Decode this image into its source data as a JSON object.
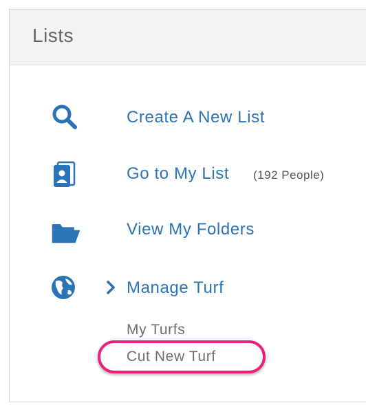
{
  "panel": {
    "title": "Lists"
  },
  "items": [
    {
      "label": "Create A New List",
      "icon": "search-icon"
    },
    {
      "label": "Go to My List",
      "icon": "contact-book-icon",
      "count": "(192 People)"
    },
    {
      "label": "View My Folders",
      "icon": "folder-open-icon"
    },
    {
      "label": "Manage Turf",
      "icon": "globe-icon",
      "expanded_icon": "chevron-right-icon"
    }
  ],
  "turf_submenu": [
    {
      "label": "My Turfs"
    },
    {
      "label": "Cut New Turf",
      "highlighted": true
    }
  ],
  "colors": {
    "link": "#2a74b5",
    "highlight": "#e8217b",
    "header_bg": "#f3f3f3"
  }
}
